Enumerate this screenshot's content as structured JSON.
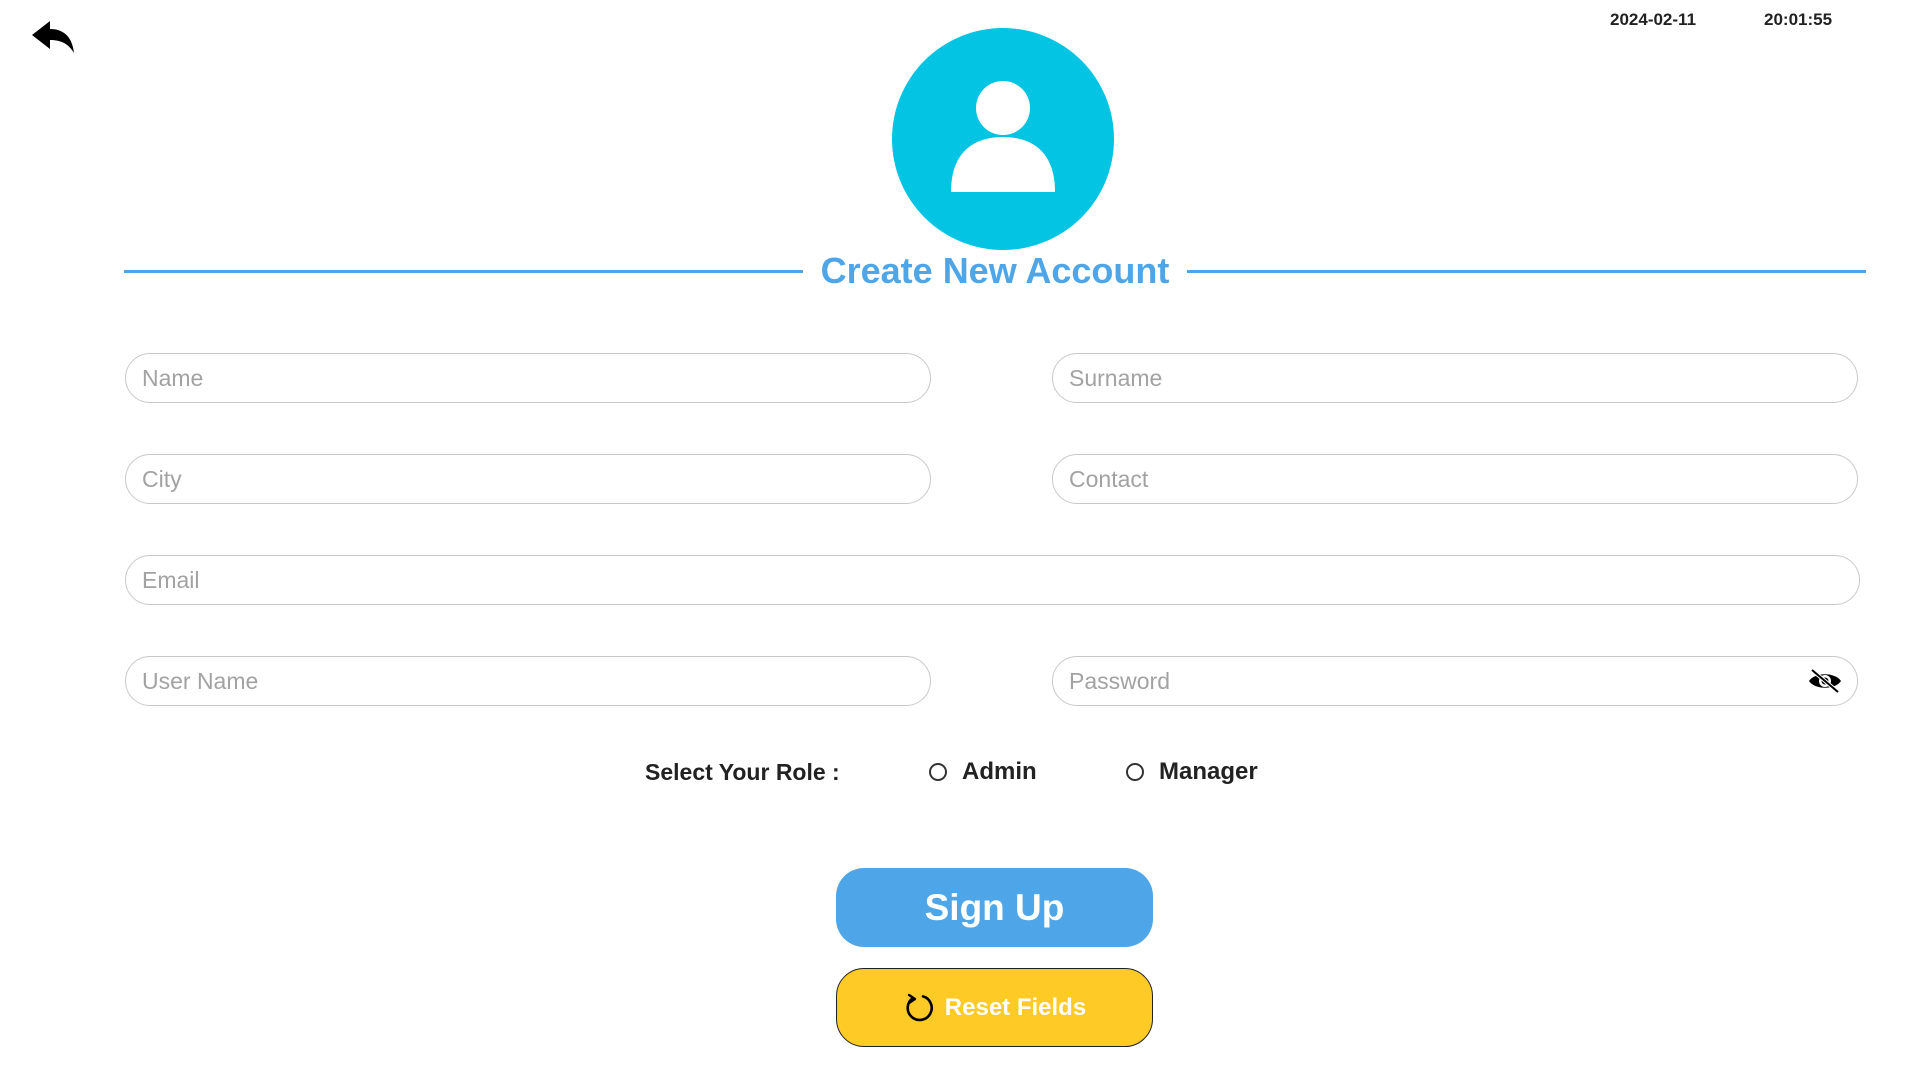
{
  "header": {
    "back_icon": "reply-arrow-icon",
    "date": "2024-02-11",
    "time": "20:01:55"
  },
  "avatar": {
    "icon": "user-icon",
    "color": "#03c4e2"
  },
  "title": "Create New Account",
  "form": {
    "name_placeholder": "Name",
    "surname_placeholder": "Surname",
    "city_placeholder": "City",
    "contact_placeholder": "Contact",
    "email_placeholder": "Email",
    "username_placeholder": "User Name",
    "password_placeholder": "Password",
    "password_toggle_icon": "eye-hidden-icon"
  },
  "role": {
    "label": "Select Your Role  :",
    "options": [
      "Admin",
      "Manager"
    ]
  },
  "buttons": {
    "signup_label": "Sign Up",
    "reset_label": "Reset Fields",
    "reset_icon": "refresh-icon"
  },
  "colors": {
    "accent": "#4ea6e8",
    "avatar": "#03c4e2",
    "reset": "#fdca26"
  }
}
